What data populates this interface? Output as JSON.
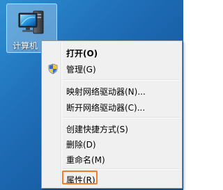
{
  "desktop": {
    "icon": {
      "label": "计算机",
      "icon": "computer-icon"
    }
  },
  "context_menu": {
    "items": [
      {
        "label": "打开(O)",
        "bold": true
      },
      {
        "label": "管理(G)",
        "icon": "uac-shield-icon"
      },
      {
        "label": "映射网络驱动器(N)..."
      },
      {
        "label": "断开网络驱动器(C)..."
      },
      {
        "label": "创建快捷方式(S)"
      },
      {
        "label": "删除(D)"
      },
      {
        "label": "重命名(M)"
      },
      {
        "label": "属性(R)",
        "highlighted": true,
        "highlight_color": "#f07d2b"
      }
    ]
  }
}
